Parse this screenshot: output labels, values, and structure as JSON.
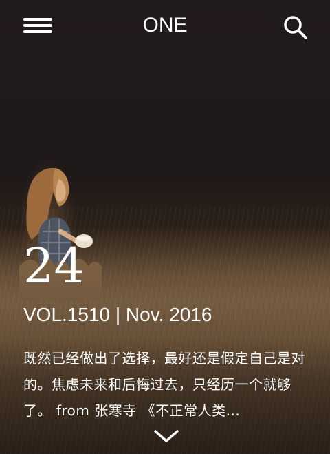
{
  "header": {
    "logo": "ONE",
    "menu_icon": "hamburger-menu-icon",
    "search_icon": "search-icon"
  },
  "feature": {
    "day": "24",
    "volume_date": "VOL.1510 | Nov. 2016",
    "quote": "既然已经做出了选择，最好还是假定自己是对的。焦虑未来和后悔过去，只经历一个就够了。 from 张寒寺 《不正常人类..."
  },
  "footer": {
    "scroll_icon": "chevron-down-icon"
  },
  "colors": {
    "text": "#ffffff",
    "sky": "#1e1819",
    "field": "#7c6245"
  }
}
